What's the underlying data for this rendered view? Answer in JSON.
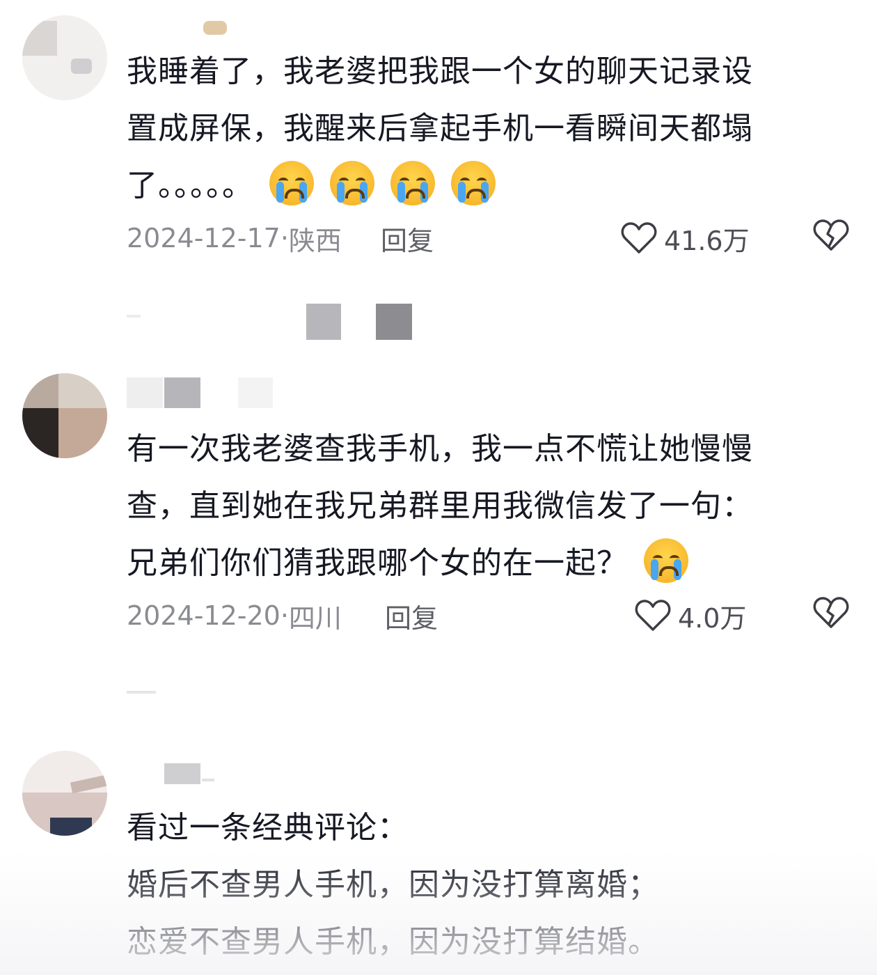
{
  "comments": [
    {
      "lines": [
        "我睡着了，我老婆把我跟一个女的聊天记录设",
        "置成屏保，我醒来后拿起手机一看瞬间天都塌",
        "了。。。。。"
      ],
      "date": "2024-12-17·",
      "location": "陕西",
      "reply_label": "回复",
      "likes": "41.6万"
    },
    {
      "lines": [
        "有一次我老婆查我手机，我一点不慌让她慢慢",
        "查，直到她在我兄弟群里用我微信发了一句：",
        "兄弟们你们猜我跟哪个女的在一起？"
      ],
      "date": "2024-12-20·",
      "location": "四川",
      "reply_label": "回复",
      "likes": "4.0万"
    },
    {
      "lines": [
        "看过一条经典评论：",
        "婚后不查男人手机，因为没打算离婚；",
        "恋爱不查男人手机，因为没打算结婚。"
      ]
    }
  ],
  "icons": {
    "emoji": "loudly-crying-face",
    "like": "heart-outline-icon",
    "dislike": "broken-heart-icon"
  },
  "colors": {
    "text": "#161823",
    "meta": "#8a8b91",
    "emoji": "#f7b52b",
    "tear": "#4aa6f0"
  }
}
